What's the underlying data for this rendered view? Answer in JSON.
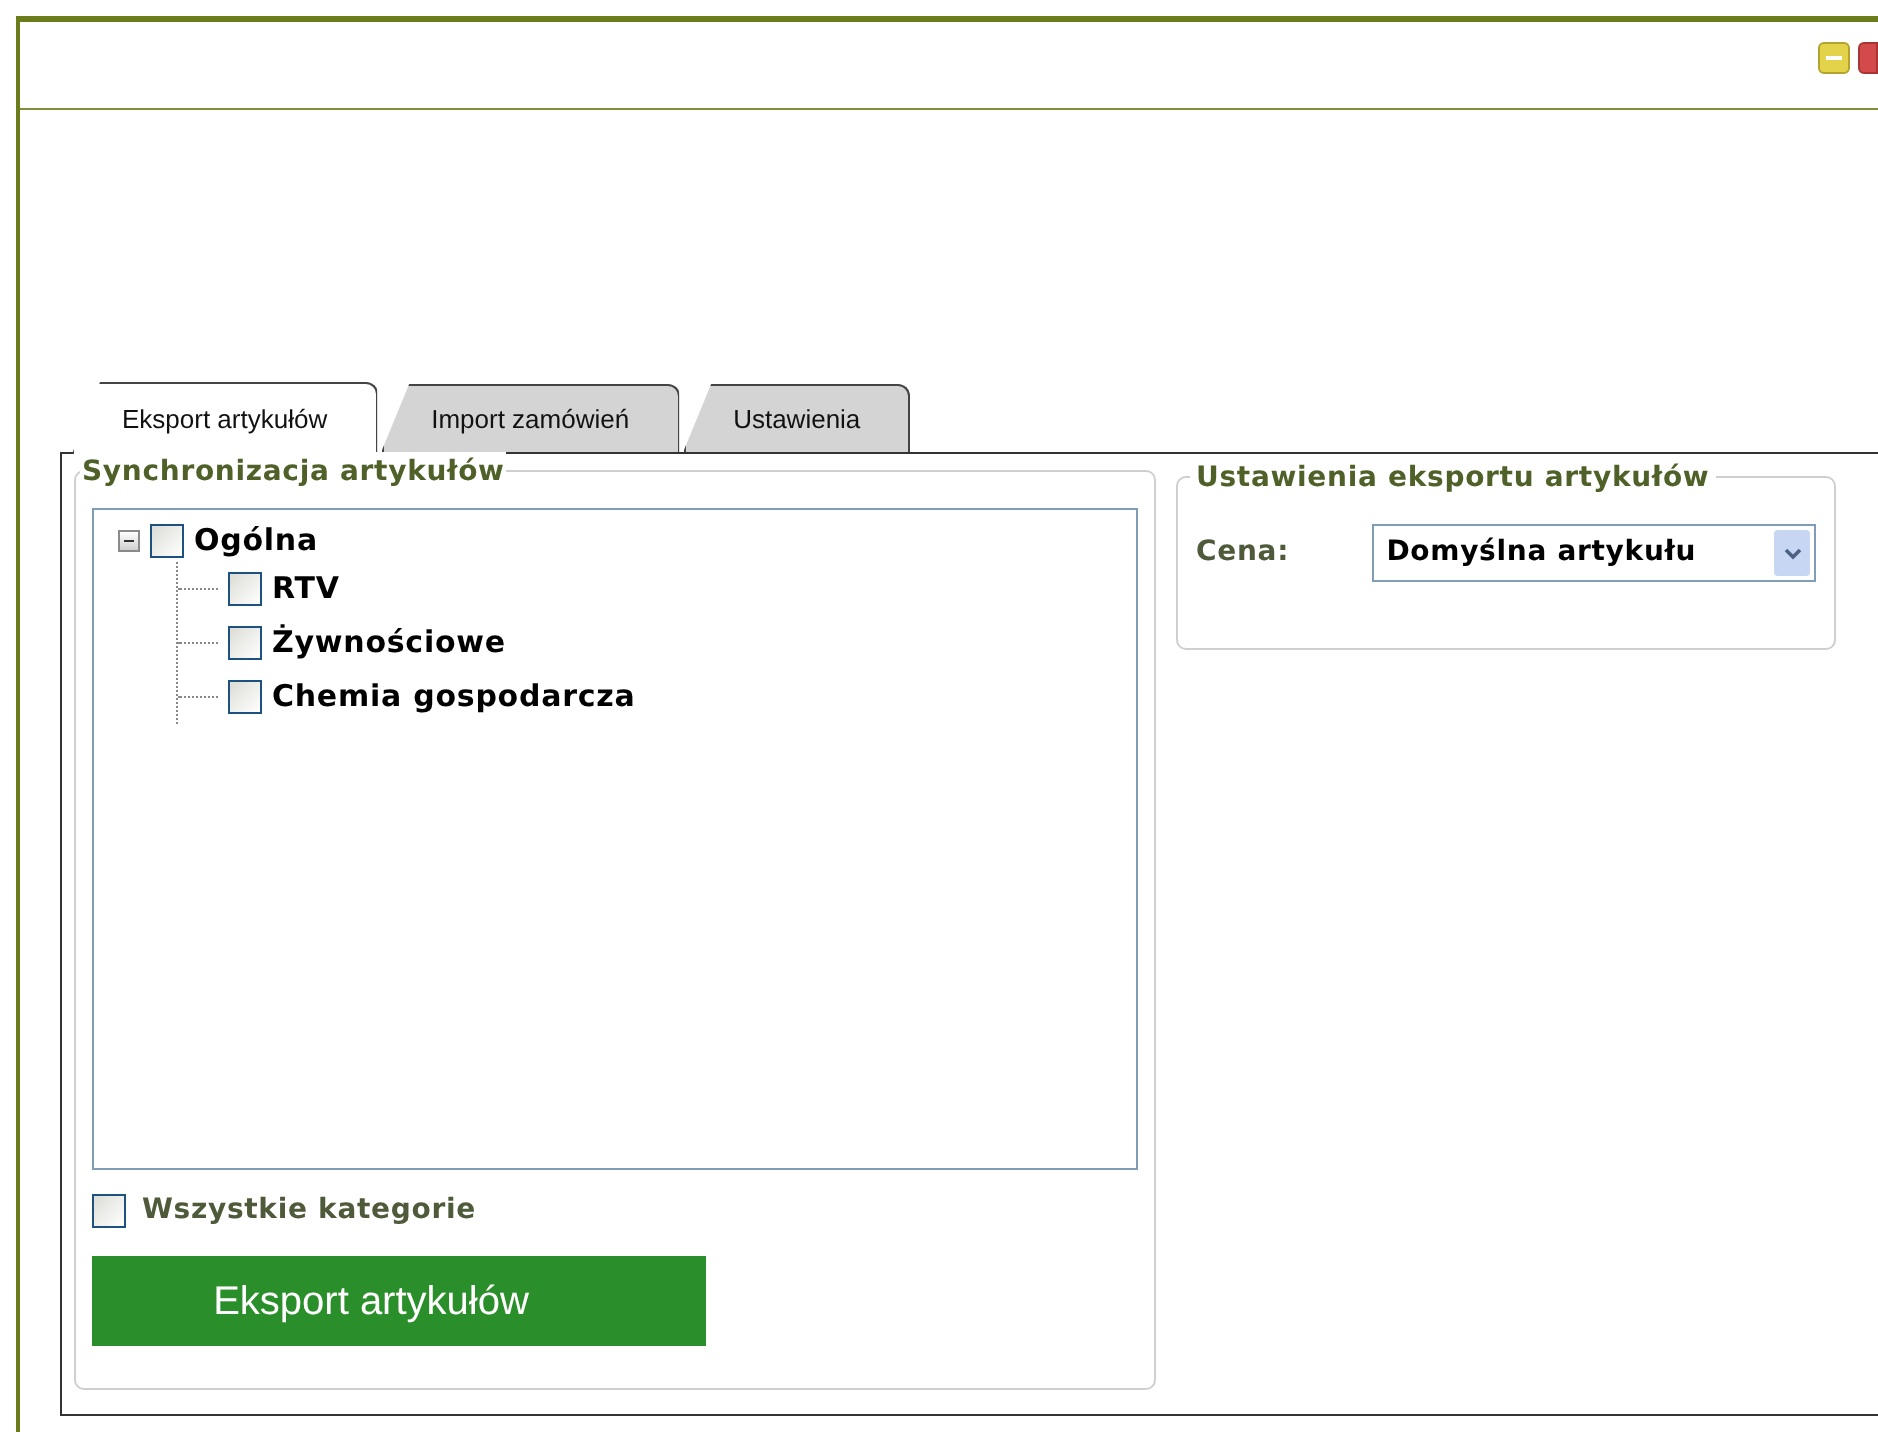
{
  "tabs": [
    {
      "label": "Eksport artykułów",
      "selected": true
    },
    {
      "label": "Import zamówień",
      "selected": false
    },
    {
      "label": "Ustawienia",
      "selected": false
    }
  ],
  "sync_group": {
    "title": "Synchronizacja artykułów",
    "tree": [
      {
        "label": "Ogólna",
        "checked": false,
        "expanded": true,
        "children": [
          {
            "label": "RTV",
            "checked": false
          },
          {
            "label": "Żywnościowe",
            "checked": false
          },
          {
            "label": "Chemia gospodarcza",
            "checked": false
          }
        ]
      }
    ],
    "all_categories": {
      "label": "Wszystkie kategorie",
      "checked": false
    },
    "export_button": "Eksport artykułów"
  },
  "export_settings": {
    "title": "Ustawienia eksportu artykułów",
    "price_label": "Cena:",
    "price_value": "Domyślna artykułu"
  }
}
